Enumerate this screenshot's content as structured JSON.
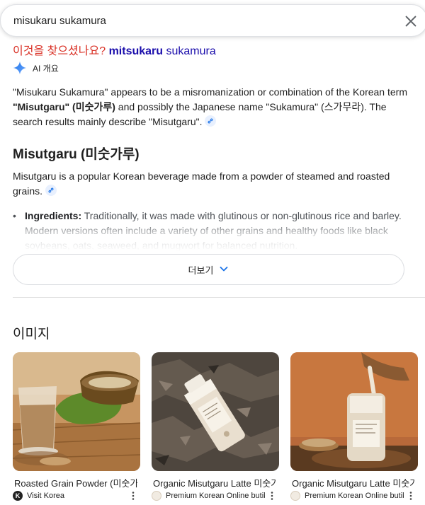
{
  "search": {
    "query": "misukaru sukamura"
  },
  "did_you_mean": {
    "prefix": "이것을 찾으셨나요?",
    "bold": "mitsukaru",
    "rest": "sukamura"
  },
  "ai_overview": {
    "label": "AI 개요",
    "intro_part1": "\"Misukaru Sukamura\" appears to be a misromanization or combination of the Korean term ",
    "intro_bold": "\"Misutgaru\" (미숫가루)",
    "intro_part2": " and possibly the Japanese name \"Sukamura\" (스가무라). The search results mainly describe \"Misutgaru\".",
    "heading": "Misutgaru (미숫가루)",
    "desc": "Misutgaru is a popular Korean beverage made from a powder of steamed and roasted grains.",
    "bullet_label": "Ingredients:",
    "bullet_text": " Traditionally, it was made with glutinous or non-glutinous rice and barley. Modern versions often include a variety of other grains and healthy foods like black soybeans, oats, seaweed, and mugwort for balanced nutrition.",
    "more_label": "더보기",
    "accent_color": "#4285f4"
  },
  "images": {
    "heading": "이미지",
    "items": [
      {
        "title": "Roasted Grain Powder (미숫가루)",
        "source": "Visit Korea",
        "source_icon": "K"
      },
      {
        "title": "Organic Misutgaru Latte 미숫가루",
        "source": "Premium Korean Online butik",
        "source_icon": ""
      },
      {
        "title": "Organic Misutgaru Latte 미숫가루",
        "source": "Premium Korean Online butik",
        "source_icon": ""
      }
    ]
  }
}
